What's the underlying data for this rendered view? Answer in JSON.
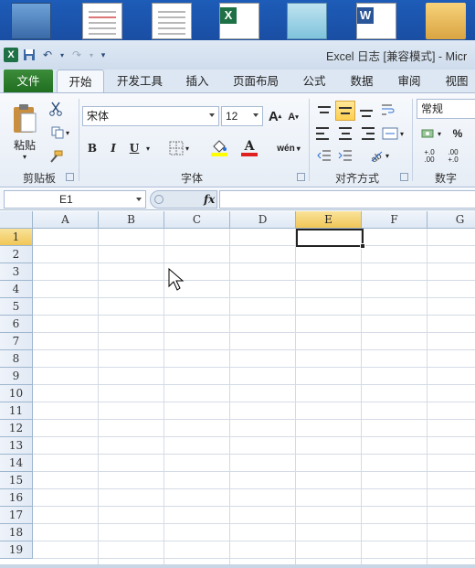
{
  "window": {
    "title": "Excel 日志  [兼容模式] - Micr"
  },
  "ribbon_tabs": [
    "文件",
    "开始",
    "开发工具",
    "插入",
    "页面布局",
    "公式",
    "数据",
    "审阅",
    "视图"
  ],
  "active_tab": "开始",
  "clipboard": {
    "paste_label": "粘贴",
    "group_label": "剪贴板"
  },
  "font": {
    "name": "宋体",
    "size": "12",
    "group_label": "字体",
    "bold": "B",
    "italic": "I",
    "underline": "U",
    "grow": "A",
    "shrink": "A",
    "font_color_letter": "A",
    "phonetic": "wén"
  },
  "alignment": {
    "group_label": "对齐方式"
  },
  "number": {
    "format": "常规",
    "percent": "%",
    "group_label": "数字",
    "inc_dec": "+.0 .00",
    "dec_dec": ".00 +.0"
  },
  "formula_bar": {
    "name_box": "E1",
    "fx_label": "fx",
    "formula": ""
  },
  "columns": [
    "A",
    "B",
    "C",
    "D",
    "E",
    "F",
    "G"
  ],
  "rows": [
    "1",
    "2",
    "3",
    "4",
    "5",
    "6",
    "7",
    "8",
    "9",
    "10",
    "11",
    "12",
    "13",
    "14",
    "15",
    "16",
    "17",
    "18",
    "19"
  ],
  "selected_cell": "E1",
  "colors": {
    "file_tab": "#2e7d32",
    "selection": "#f1c657",
    "font_color_bar": "#e02020",
    "fill_bar": "#ffff00"
  }
}
